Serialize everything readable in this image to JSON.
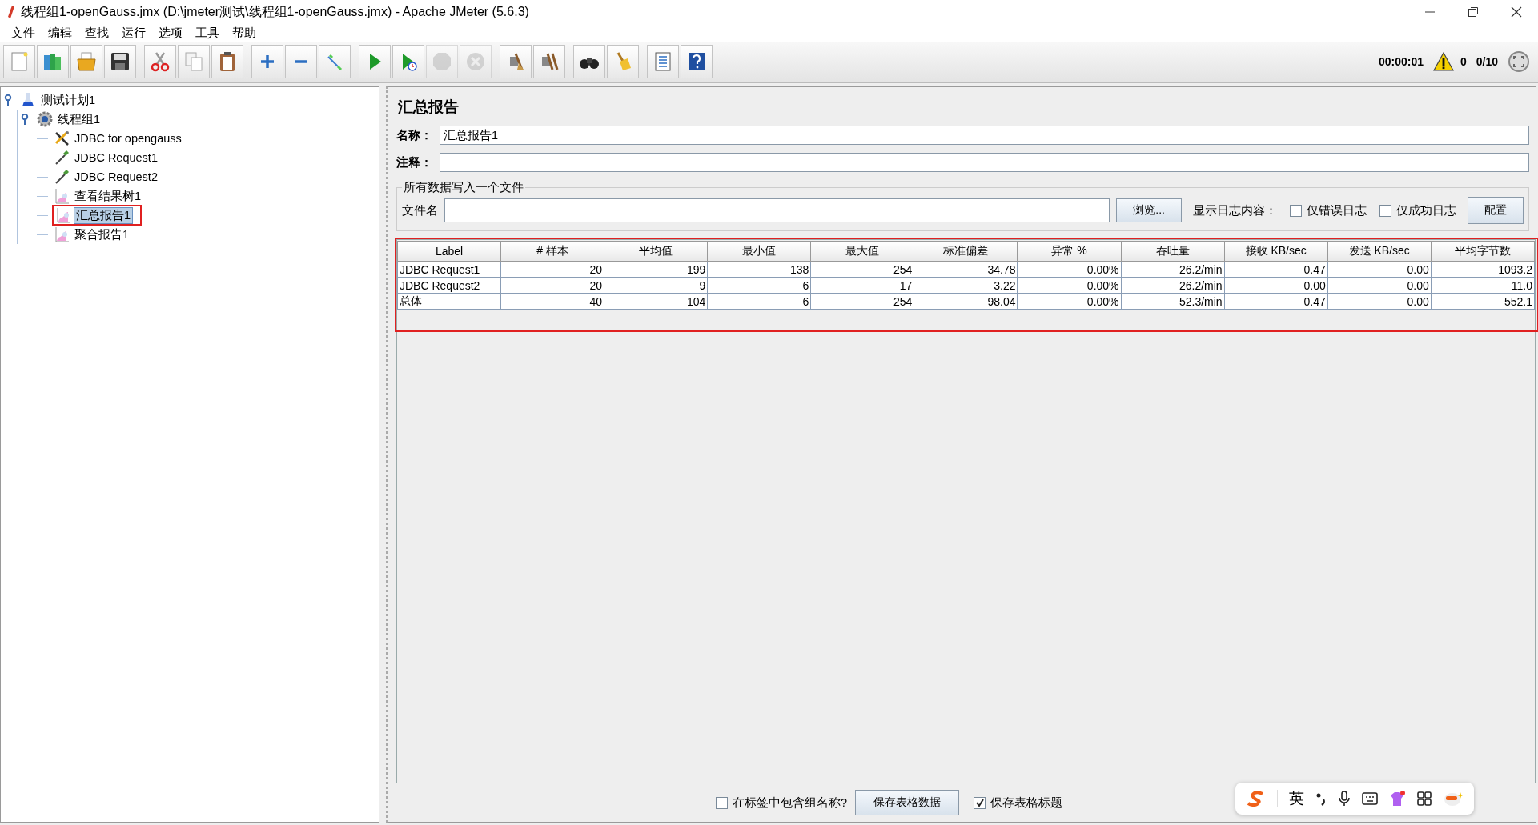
{
  "window": {
    "title": "线程组1-openGauss.jmx (D:\\jmeter测试\\线程组1-openGauss.jmx) - Apache JMeter (5.6.3)"
  },
  "menu": [
    "文件",
    "编辑",
    "查找",
    "运行",
    "选项",
    "工具",
    "帮助"
  ],
  "toolbar": {
    "groups": [
      [
        {
          "kind": "new",
          "disabled": false
        },
        {
          "kind": "templates",
          "disabled": false
        },
        {
          "kind": "open",
          "disabled": false
        },
        {
          "kind": "save",
          "disabled": false
        }
      ],
      [
        {
          "kind": "cut",
          "disabled": false
        },
        {
          "kind": "copy",
          "disabled": false
        },
        {
          "kind": "paste",
          "disabled": false
        }
      ],
      [
        {
          "kind": "expand",
          "disabled": false
        },
        {
          "kind": "collapse",
          "disabled": false
        },
        {
          "kind": "toggle",
          "disabled": false
        }
      ],
      [
        {
          "kind": "start",
          "disabled": false
        },
        {
          "kind": "start_no_pause",
          "disabled": false
        },
        {
          "kind": "stop",
          "disabled": true
        },
        {
          "kind": "shutdown",
          "disabled": true
        }
      ],
      [
        {
          "kind": "clear",
          "disabled": false
        },
        {
          "kind": "clear_all",
          "disabled": false
        }
      ],
      [
        {
          "kind": "search",
          "disabled": false
        },
        {
          "kind": "reset_search",
          "disabled": false
        }
      ],
      [
        {
          "kind": "functions",
          "disabled": false
        },
        {
          "kind": "help",
          "disabled": false
        }
      ]
    ],
    "elapsed": "00:00:01",
    "warnings": "0",
    "threads": "0/10"
  },
  "tree": [
    {
      "label": "测试计划1",
      "kind": "plan",
      "expanded": true,
      "selected": false,
      "annotated": false,
      "children": [
        {
          "label": "线程组1",
          "kind": "threads",
          "expanded": true,
          "selected": false,
          "annotated": false,
          "children": [
            {
              "label": "JDBC for opengauss",
              "kind": "config",
              "selected": false,
              "annotated": false
            },
            {
              "label": "JDBC Request1",
              "kind": "sampler",
              "selected": false,
              "annotated": false
            },
            {
              "label": "JDBC Request2",
              "kind": "sampler",
              "selected": false,
              "annotated": false
            },
            {
              "label": "查看结果树1",
              "kind": "listener",
              "selected": false,
              "annotated": false
            },
            {
              "label": "汇总报告1",
              "kind": "listener",
              "selected": true,
              "annotated": true
            },
            {
              "label": "聚合报告1",
              "kind": "listener",
              "selected": false,
              "annotated": false
            }
          ]
        }
      ]
    }
  ],
  "panel": {
    "title": "汇总报告",
    "name_label": "名称：",
    "name_value": "汇总报告1",
    "comment_label": "注释：",
    "file_group": {
      "title": "所有数据写入一个文件",
      "file_label": "文件名",
      "browse": "浏览...",
      "log_label": "显示日志内容：",
      "options": [
        {
          "label": "仅错误日志",
          "checked": false
        },
        {
          "label": "仅成功日志",
          "checked": false
        }
      ],
      "configure": "配置"
    },
    "table": {
      "annotated": true,
      "columns": [
        "Label",
        "# 样本",
        "平均值",
        "最小值",
        "最大值",
        "标准偏差",
        "异常 %",
        "吞吐量",
        "接收 KB/sec",
        "发送 KB/sec",
        "平均字节数"
      ],
      "rows": [
        [
          "JDBC Request1",
          "20",
          "199",
          "138",
          "254",
          "34.78",
          "0.00%",
          "26.2/min",
          "0.47",
          "0.00",
          "1093.2"
        ],
        [
          "JDBC Request2",
          "20",
          "9",
          "6",
          "17",
          "3.22",
          "0.00%",
          "26.2/min",
          "0.00",
          "0.00",
          "11.0"
        ],
        [
          "总体",
          "40",
          "104",
          "6",
          "254",
          "98.04",
          "0.00%",
          "52.3/min",
          "0.47",
          "0.00",
          "552.1"
        ]
      ]
    },
    "footer": {
      "include_group": {
        "label": "在标签中包含组名称?",
        "checked": false
      },
      "save_data": "保存表格数据",
      "save_header": {
        "label": "保存表格标题",
        "checked": true
      }
    }
  },
  "ime_bar": {
    "language": "英"
  }
}
